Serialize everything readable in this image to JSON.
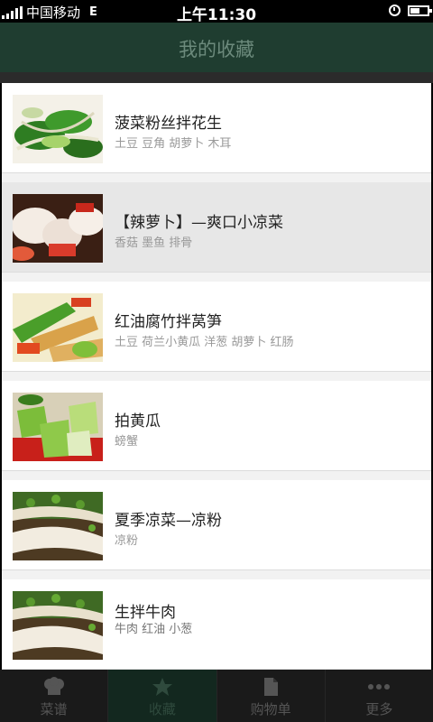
{
  "status_bar": {
    "carrier": "中国移动",
    "network": "E",
    "time": "上午11:30"
  },
  "header": {
    "title": "我的收藏"
  },
  "favorites": [
    {
      "name": "菠菜粉丝拌花生",
      "tags": "土豆  豆角  胡萝卜  木耳",
      "image": "spinach-salad-photo"
    },
    {
      "name": "【辣萝卜】—爽口小凉菜",
      "tags": "香菇  墨鱼  排骨",
      "image": "spicy-radish-photo"
    },
    {
      "name": "红油腐竹拌莴笋",
      "tags": "土豆  荷兰小黄瓜  洋葱  胡萝卜  红肠",
      "image": "beancurd-lettuce-photo"
    },
    {
      "name": "拍黄瓜",
      "tags": "螃蟹",
      "image": "smashed-cucumber-photo"
    },
    {
      "name": "夏季凉菜—凉粉",
      "tags": "凉粉",
      "image": "cold-noodle-photo"
    },
    {
      "name": "生拌牛肉",
      "tags": "牛肉 红油 小葱",
      "image": "raw-beef-photo"
    }
  ],
  "tabs": [
    {
      "label": "菜谱",
      "icon": "chef-hat-icon"
    },
    {
      "label": "收藏",
      "icon": "star-icon"
    },
    {
      "label": "购物单",
      "icon": "document-icon"
    },
    {
      "label": "更多",
      "icon": "more-dots-icon"
    }
  ],
  "colors": {
    "title_bar": "#1f3d30",
    "active_tab": "#13281f",
    "selected_row": "#e7e7e7"
  }
}
